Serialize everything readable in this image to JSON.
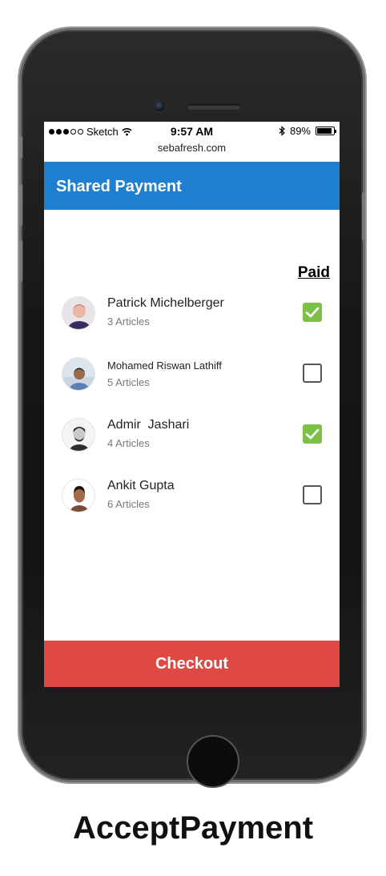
{
  "status_bar": {
    "carrier": "Sketch",
    "time": "9:57 AM",
    "battery": "89%",
    "battery_level": 0.89,
    "url": "sebafresh.com"
  },
  "header": {
    "title": "Shared Payment"
  },
  "list": {
    "paid_label": "Paid",
    "people": [
      {
        "name": "Patrick Michelberger",
        "articles": "3 Articles",
        "paid": true,
        "avatar": "avatar-patrick"
      },
      {
        "name": "Mohamed Riswan Lathiff",
        "articles": "5 Articles",
        "paid": false,
        "avatar": "avatar-mohamed"
      },
      {
        "name": "Admir  Jashari",
        "articles": "4 Articles",
        "paid": true,
        "avatar": "avatar-admir"
      },
      {
        "name": "Ankit Gupta",
        "articles": "6 Articles",
        "paid": false,
        "avatar": "avatar-ankit"
      }
    ]
  },
  "checkout_label": "Checkout",
  "caption": "AcceptPayment",
  "colors": {
    "header_blue": "#1f7fd0",
    "checkout_red": "#de4943",
    "check_green": "#7cc146"
  }
}
